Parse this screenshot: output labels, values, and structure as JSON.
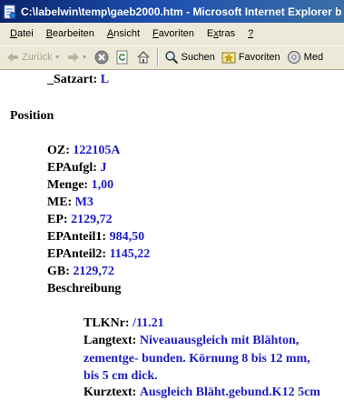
{
  "window": {
    "title": "C:\\labelwin\\temp\\gaeb2000.htm - Microsoft Internet Explorer b"
  },
  "menu": {
    "items": [
      {
        "pre": "",
        "ul": "D",
        "post": "atei"
      },
      {
        "pre": "",
        "ul": "B",
        "post": "earbeiten"
      },
      {
        "pre": "",
        "ul": "A",
        "post": "nsicht"
      },
      {
        "pre": "",
        "ul": "F",
        "post": "avoriten"
      },
      {
        "pre": "E",
        "ul": "x",
        "post": "tras"
      },
      {
        "pre": "",
        "ul": "?",
        "post": ""
      }
    ]
  },
  "toolbar": {
    "back_label": "Zurück",
    "search_label": "Suchen",
    "favorites_label": "Favoriten",
    "media_label": "Med"
  },
  "content": {
    "satzart_label": "_Satzart:",
    "satzart_value": "L",
    "section_heading": "Position",
    "fields": [
      {
        "label": "OZ:",
        "value": "122105A"
      },
      {
        "label": "EPAufgl:",
        "value": "J"
      },
      {
        "label": "Menge:",
        "value": "1,00"
      },
      {
        "label": "ME:",
        "value": "M3"
      },
      {
        "label": "EP:",
        "value": "2129,72"
      },
      {
        "label": "EPAnteil1:",
        "value": "984,50"
      },
      {
        "label": "EPAnteil2:",
        "value": "1145,22"
      },
      {
        "label": "GB:",
        "value": "2129,72"
      }
    ],
    "beschreibung_label": "Beschreibung",
    "tlknr_label": "TLKNr:",
    "tlknr_value": "/11.21",
    "langtext_label": "Langtext:",
    "langtext_line1": "Niveauausgleich mit Blähton,",
    "langtext_line2": "zementge- bunden. Körnung 8 bis 12 mm,",
    "langtext_line3": "bis 5 cm dick.",
    "kurztext_label": "Kurztext:",
    "kurztext_value": "Ausgleich Bläht.gebund.K12 5cm"
  },
  "colors": {
    "value_text": "#1c1cc4",
    "titlebar": "#0a246a",
    "chrome": "#ece9d8"
  }
}
